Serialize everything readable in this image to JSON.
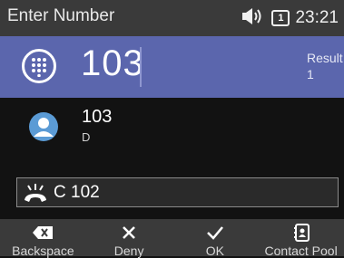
{
  "status": {
    "title": "Enter Number",
    "line_number": "1",
    "time": "23:21"
  },
  "input": {
    "value": "103",
    "result_label": "Result",
    "result_count": "1"
  },
  "results": [
    {
      "name": "103",
      "sub": "D"
    }
  ],
  "active_call": {
    "text": "C 102"
  },
  "softkeys": [
    {
      "label": "Backspace",
      "icon": "backspace-icon"
    },
    {
      "label": "Deny",
      "icon": "close-icon"
    },
    {
      "label": "OK",
      "icon": "check-icon"
    },
    {
      "label": "Contact Pool",
      "icon": "contacts-icon"
    }
  ],
  "colors": {
    "status_bar": "#3a3a3a",
    "input_bg": "#5b66ad",
    "background": "#121212",
    "avatar": "#5b9bd5"
  }
}
